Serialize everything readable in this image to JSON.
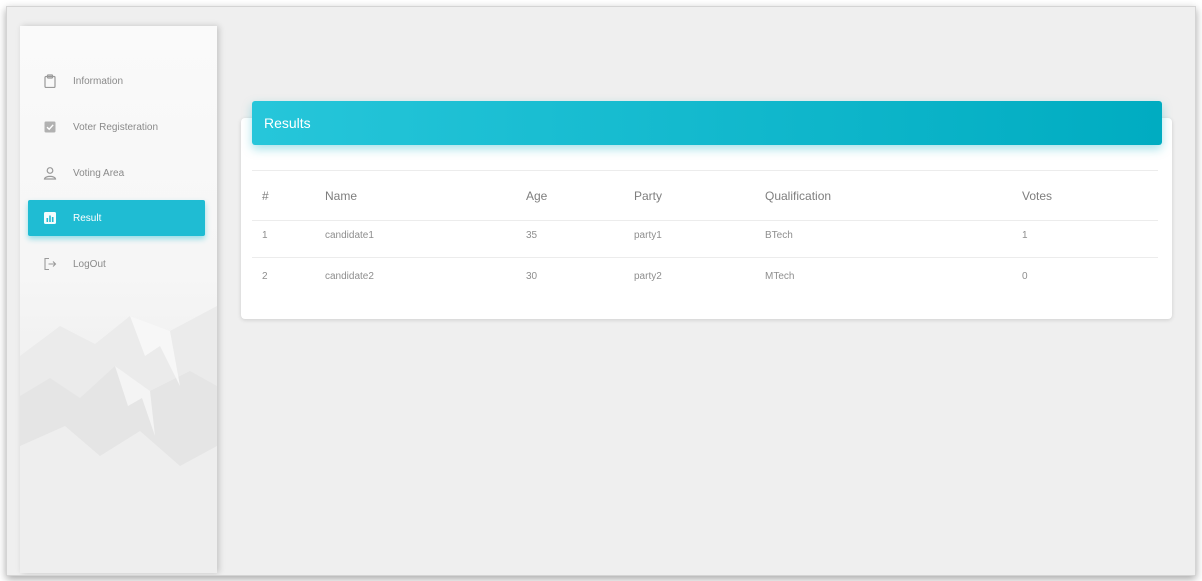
{
  "sidebar": {
    "items": [
      {
        "label": "Information",
        "icon": "clipboard-icon",
        "active": false
      },
      {
        "label": "Voter Registeration",
        "icon": "checkbox-icon",
        "active": false
      },
      {
        "label": "Voting Area",
        "icon": "user-icon",
        "active": false
      },
      {
        "label": "Result",
        "icon": "bar-chart-icon",
        "active": true
      },
      {
        "label": "LogOut",
        "icon": "logout-icon",
        "active": false
      }
    ]
  },
  "card": {
    "title": "Results"
  },
  "table": {
    "columns": [
      "#",
      "Name",
      "Age",
      "Party",
      "Qualification",
      "Votes"
    ],
    "rows": [
      [
        "1",
        "candidate1",
        "35",
        "party1",
        "BTech",
        "1"
      ],
      [
        "2",
        "candidate2",
        "30",
        "party2",
        "MTech",
        "0"
      ]
    ]
  },
  "colors": {
    "accent": "#1fbcd3",
    "header_gradient_start": "#26c6da",
    "header_gradient_end": "#00acc1",
    "background": "#efefef"
  }
}
